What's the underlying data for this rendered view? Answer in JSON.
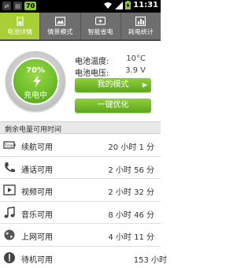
{
  "status_bar": {
    "battery_level": "70",
    "time": "11:31"
  },
  "tabs": [
    {
      "label": "电池详情",
      "active": true
    },
    {
      "label": "情景模式",
      "active": false
    },
    {
      "label": "智能省电",
      "active": false
    },
    {
      "label": "耗电统计",
      "active": false
    }
  ],
  "battery": {
    "percent": "70%",
    "status": "充电中",
    "temperature_label": "电池温度:",
    "temperature_value": "10°C",
    "voltage_label": "电池电压:",
    "voltage_value": "3.9 V"
  },
  "buttons": {
    "my_mode": "我的模式",
    "optimize": "一键优化"
  },
  "section_title": "剩余电量可用时间",
  "usage_rows": [
    {
      "label": "续航可用",
      "value": "20 小时 1 分",
      "icon": "battery-time-icon"
    },
    {
      "label": "通话可用",
      "value": "2 小时 56 分",
      "icon": "phone-icon"
    },
    {
      "label": "视频可用",
      "value": "2 小时 32 分",
      "icon": "video-icon"
    },
    {
      "label": "音乐可用",
      "value": "8 小时 46 分",
      "icon": "music-note-icon"
    },
    {
      "label": "上网可用",
      "value": "4 小时 11 分",
      "icon": "globe-icon"
    },
    {
      "label": "待机可用",
      "value": "153 小时",
      "icon": "power-icon"
    }
  ],
  "colors": {
    "accent_green": "#8cc63f",
    "tab_bar": "#6e6e6e"
  }
}
